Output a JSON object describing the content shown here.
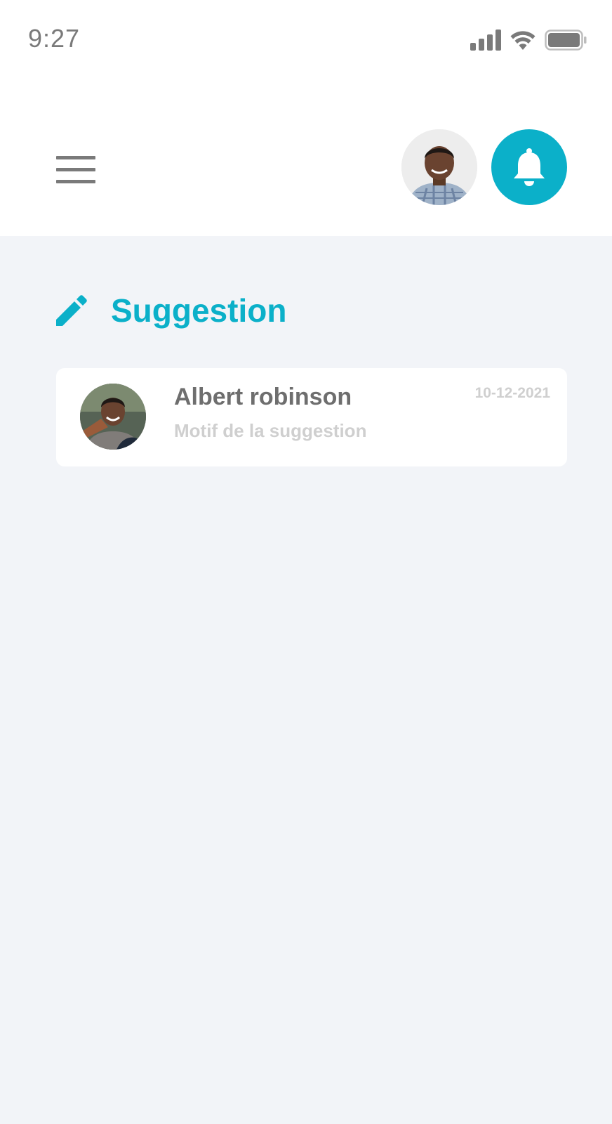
{
  "status_bar": {
    "time": "9:27",
    "icons": [
      "signal-icon",
      "wifi-icon",
      "battery-icon"
    ]
  },
  "header": {
    "menu_icon": "hamburger-menu-icon",
    "notification_icon": "bell-icon",
    "accent_color": "#0bb0c9"
  },
  "section": {
    "icon": "pencil-icon",
    "title": "Suggestion"
  },
  "suggestions": [
    {
      "name": "Albert robinson",
      "subtitle": "Motif de la suggestion",
      "date": "10-12-2021"
    }
  ]
}
